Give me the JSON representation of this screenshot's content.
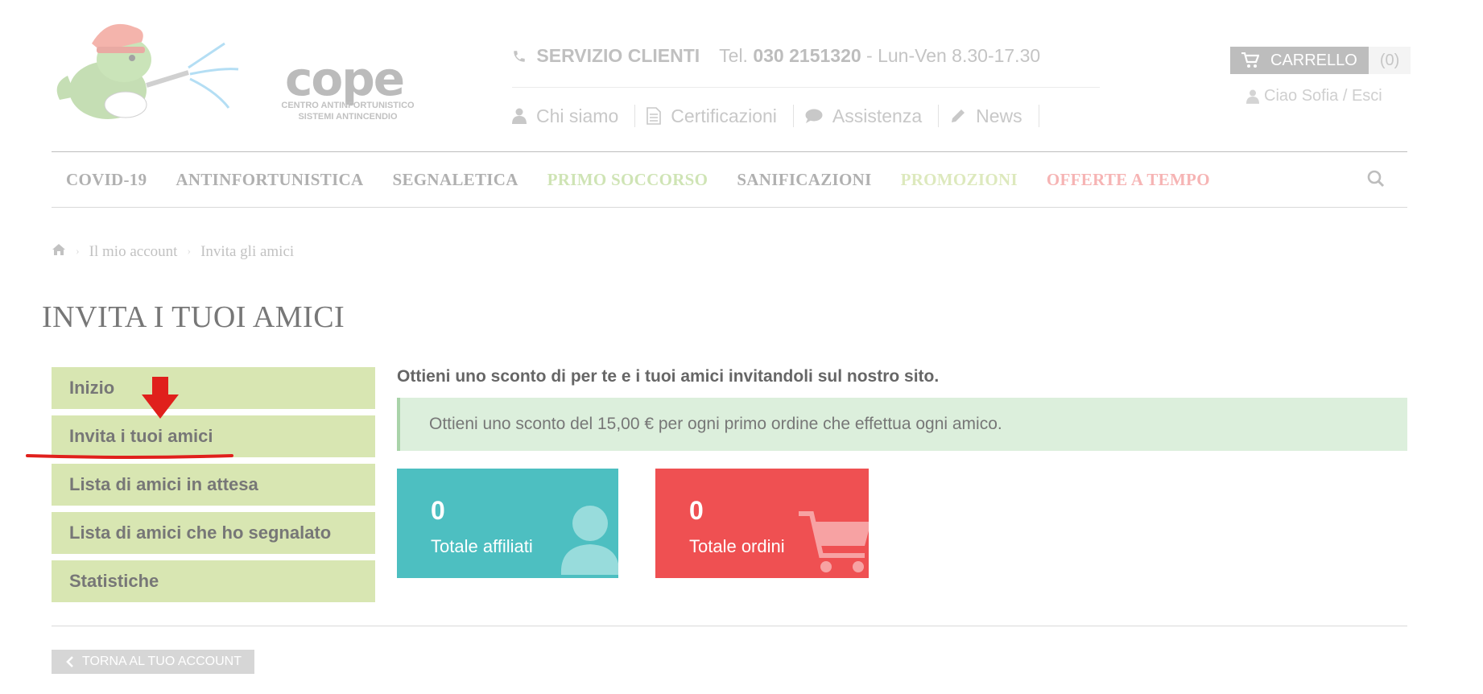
{
  "header": {
    "logo": {
      "word": "cope",
      "subtitle_line1": "CENTRO ANTINFORTUNISTICO",
      "subtitle_line2": "SISTEMI ANTINCENDIO"
    },
    "service": {
      "label": "SERVIZIO CLIENTI",
      "tel_prefix": "Tel.",
      "tel_number": "030 2151320",
      "hours": "- Lun-Ven 8.30-17.30"
    },
    "links": [
      {
        "label": "Chi siamo",
        "icon": "user-icon"
      },
      {
        "label": "Certificazioni",
        "icon": "document-icon"
      },
      {
        "label": "Assistenza",
        "icon": "comment-icon"
      },
      {
        "label": "News",
        "icon": "pencil-icon"
      }
    ],
    "cart": {
      "label": "CARRELLO",
      "count": "(0)"
    },
    "greeting": "Ciao Sofia / Esci"
  },
  "nav": {
    "items": [
      "COVID-19",
      "ANTINFORTUNISTICA",
      "SEGNALETICA",
      "PRIMO SOCCORSO",
      "SANIFICAZIONI",
      "PROMOZIONI",
      "OFFERTE A TEMPO"
    ],
    "colors": {
      "default": "#b0b0b0",
      "primo_soccorso": "#cfe4b5",
      "promozioni": "#dde9bd",
      "offerte": "#f6b4b4"
    }
  },
  "breadcrumb": [
    "Il mio account",
    "Invita gli amici"
  ],
  "page_title": "INVITA I TUOI AMICI",
  "sidebar": {
    "items": [
      {
        "label": "Inizio"
      },
      {
        "label": "Invita i tuoi amici"
      },
      {
        "label": "Lista di amici in attesa"
      },
      {
        "label": "Lista di amici che ho segnalato"
      },
      {
        "label": "Statistiche"
      }
    ]
  },
  "content": {
    "intro": "Ottieni uno sconto di per te e i tuoi amici invitandoli sul nostro sito.",
    "alert": "Ottieni uno sconto del 15,00 € per ogni primo ordine che effettua ogni amico.",
    "stats": [
      {
        "value": "0",
        "label": "Totale affiliati",
        "color": "#4dbfc1"
      },
      {
        "value": "0",
        "label": "Totale ordini",
        "color": "#ef5052"
      }
    ]
  },
  "back_button": "TORNA AL TUO ACCOUNT",
  "annotation_color": "#e0201c"
}
